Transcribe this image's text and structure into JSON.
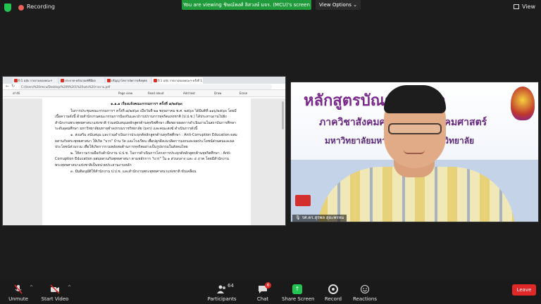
{
  "topbar": {
    "recording_label": "Recording",
    "banner_text": "You are viewing ชิษณ์พงศ์ ลิสวงษ์ มจร. (MCU)'s screen",
    "view_options_label": "View Options",
    "view_label": "View"
  },
  "shared_screen": {
    "tabs": [
      "ปี 1 ฉบับ รายงานของคณะฯ",
      "ประกาศ-หลักเกณฑ์ที่มีผล",
      "ปริญญาโทการจัดการเชิงพุทธ",
      "ปี 1 ฉบับ รายงานของคณะฯ ครั้งที่ 1"
    ],
    "url": "C:/Users/%20rmcu/Desktop/%20ปี%201%20ฉบับ%20รายงาน.pdf",
    "pdf_tools": {
      "page_indicator": "of 46",
      "page_view": "Page view",
      "read_aloud": "Read aloud",
      "add_text": "Add text",
      "draw": "Draw",
      "erase": "Erase"
    },
    "document": {
      "heading": "๑.๑.๑ เรื่องแจ้งคณะกรรมการฯ ครั้งที่ ๗/๒๕๖๓",
      "paragraphs": [
        "ในการประชุมคณะกรรมการฯ ครั้งที่ ๗/๒๕๖๓ เมื่อวันที่ ๒๑ พฤษภาคม พ.ศ. ๒๕๖๓ ได้มีมติที่ ๑๑๖/๒๕๖๓ โดยมีเนื้อความดังนี้ ด้วยสำนักงานคณะกรรมการป้องกันและปราบปรามการทุจริตแห่งชาติ (ป.ป.ช.) ได้ประสานงานไปยังสำนักงานพระพุทธศาสนาแห่งชาติ ร่วมสนับสนุนหลักสูตรต้านทุจริตศึกษา เพื่อขยายผลการดำเนินงานในสถาบันการศึกษาระดับอุดมศึกษา มหาวิทยาลัยมหาจุฬาลงกรณราชวิทยาลัย (มจร) และคณะสงฆ์ ดำเนินการดังนี้",
        "๑. ส่งเสริม สนับสนุน และร่วมดำเนินการประยุกต์หลักสูตรต้านทุจริตศึกษา : Anti-Corruption Education ผสมผสานกับพระพุทธศาสนา ให้เกิด \"บวร\" บ้าน วัด และโรงเรียน เพื่อปลูกฝังแนวคิดการแยกแยะผลประโยชน์ส่วนตนและผลประโยชน์ส่วนรวม เพื่อให้เกิดการรวมพลังต่อต้านการทุจริตอย่างเป็นรูปธรรมในสังคมไทย",
        "๒. ให้ความร่วมมือกับสำนักงาน ป.ป.ช. ในการดำเนินการโครงการประยุกต์หลักสูตรต้านทุจริตศึกษา : Anti-Corruption Education ผสมผสานกับพุทธศาสนา ตามหลักการ \"บวร\" ใน ๑ ส่วนกลาง และ ๔ ภาค โดยมีสำนักงานพระพุทธศาสนาแห่งชาติเป็นหน่วยประสานงานหลัก",
        "๓. มีมติอนุมัติให้สำนักงาน ป.ป.ช. และสำนักงานพระพุทธศาสนาแห่งชาติ ขับเคลื่อน"
      ]
    }
  },
  "video": {
    "banner_line1": "หลักสูตรบัณฑิตศึกษา",
    "banner_line2": "ภาควิชาสังคมศาสตร์ คณะสังคมศาสตร์",
    "banner_line3": "มหาวิทยาลัยมหาจุฬาลงกรณราชวิทยาลัย",
    "participant_name": "รศ.ดร.สุรพล สุยะพรหม"
  },
  "toolbar": {
    "unmute": "Unmute",
    "start_video": "Start Video",
    "participants": "Participants",
    "participants_count": "64",
    "chat": "Chat",
    "chat_badge": "6",
    "share_screen": "Share Screen",
    "record": "Record",
    "reactions": "Reactions",
    "leave": "Leave"
  },
  "colors": {
    "accent_green": "#23c552",
    "leave_red": "#e02828",
    "banner_green": "#1f9b3b"
  }
}
